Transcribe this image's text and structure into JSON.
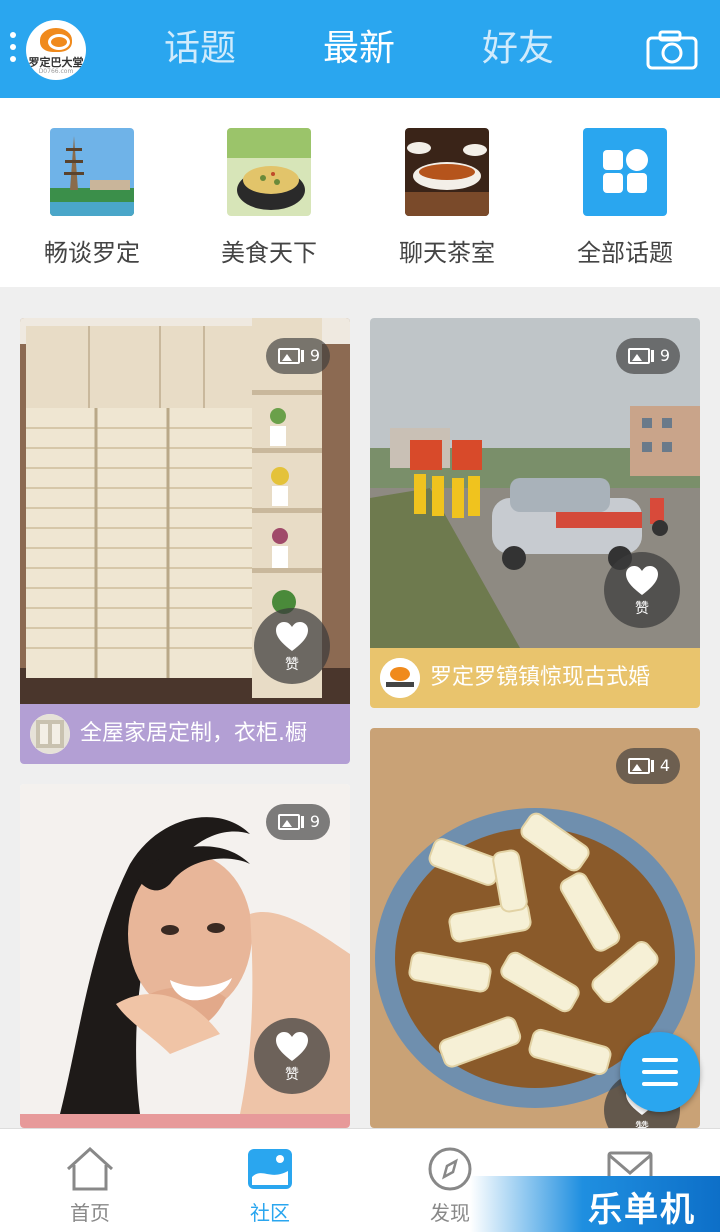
{
  "header": {
    "logo_text": "罗定巴大堂",
    "logo_sub": "D0766.com",
    "tabs": [
      {
        "label": "话题",
        "active": false
      },
      {
        "label": "最新",
        "active": true
      },
      {
        "label": "好友",
        "active": false
      }
    ],
    "camera_icon": "camera-icon"
  },
  "categories": [
    {
      "label": "畅谈罗定",
      "icon": "pagoda-photo"
    },
    {
      "label": "美食天下",
      "icon": "food-photo"
    },
    {
      "label": "聊天茶室",
      "icon": "tea-photo"
    },
    {
      "label": "全部话题",
      "icon": "grid-icon"
    }
  ],
  "feed": [
    {
      "image_count": "9",
      "like_label": "赞",
      "caption": "全屋家居定制，衣柜.橱",
      "caption_color": "#b39fd4",
      "subject": "wardrobe"
    },
    {
      "image_count": "9",
      "like_label": "赞",
      "caption": "罗定罗镜镇惊现古式婚",
      "caption_color": "#e9c46d",
      "subject": "wedding-parade"
    },
    {
      "image_count": "9",
      "like_label": "赞",
      "caption": "",
      "caption_color": "#e79a9a",
      "subject": "woman-hair"
    },
    {
      "image_count": "4",
      "like_label": "赞",
      "caption": "",
      "caption_color": "",
      "subject": "rice-noodle-dish"
    }
  ],
  "bottom_nav": [
    {
      "label": "首页",
      "icon": "home-icon",
      "active": false
    },
    {
      "label": "社区",
      "icon": "community-icon",
      "active": true
    },
    {
      "label": "发现",
      "icon": "compass-icon",
      "active": false
    },
    {
      "label": "",
      "icon": "mail-icon",
      "active": false
    }
  ],
  "watermark": "乐单机",
  "colors": {
    "primary": "#2aa6ef",
    "background": "#efefef"
  }
}
